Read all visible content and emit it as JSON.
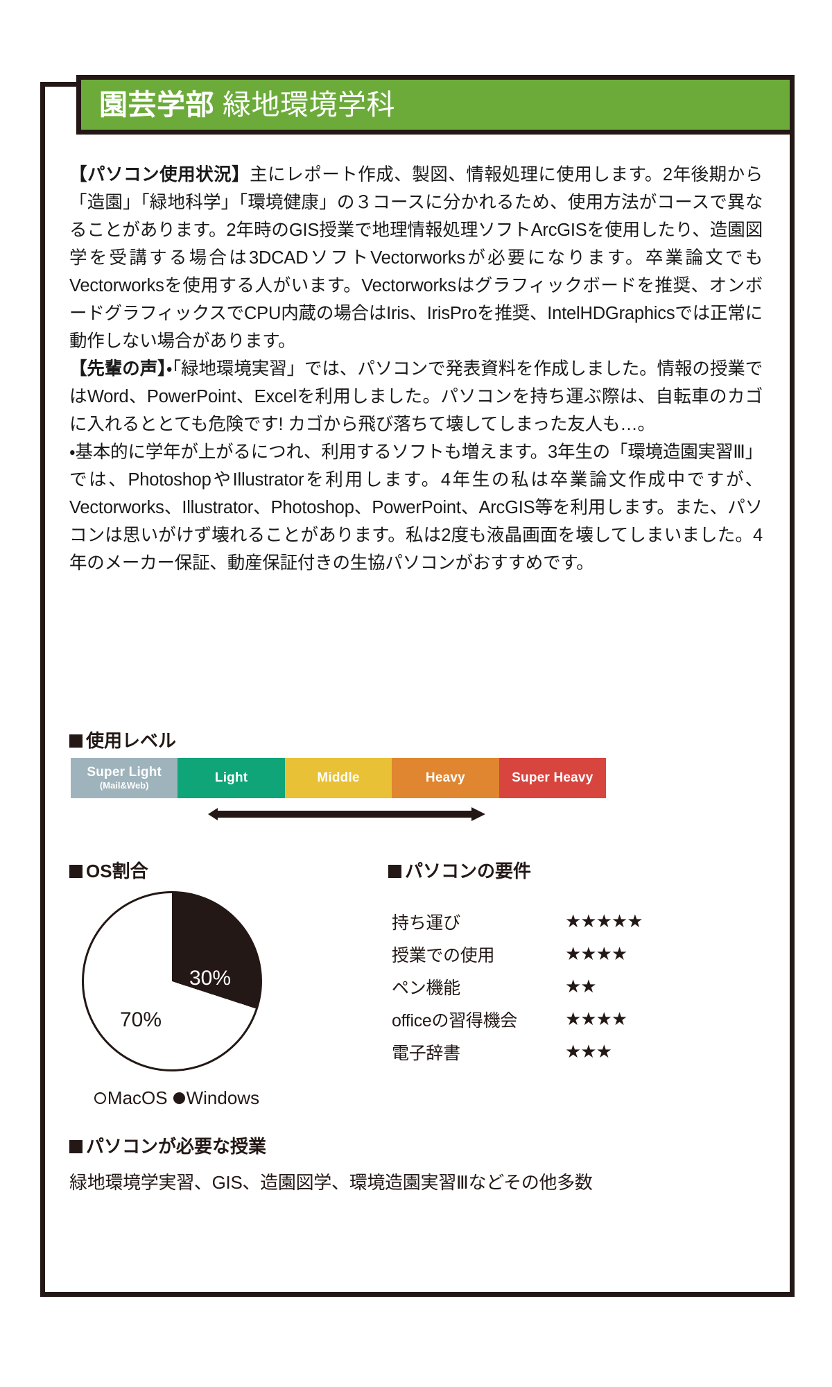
{
  "header": {
    "faculty": "園芸学部",
    "department": "緑地環境学科",
    "band_color": "#6cab3a"
  },
  "body": {
    "paragraph1": "【パソコン使用状況】主にレポート作成、製図、情報処理に使用します。2年後期から「造園」「緑地科学」「環境健康」の３コースに分かれるため、使用方法がコースで異なることがあります。2年時のGIS授業で地理情報処理ソフトArcGISを使用したり、造園図学を受講する場合は3DCADソフトVectorworksが必要になります。卒業論文でもVectorworksを使用する人がいます。Vectorworksはグラフィックボードを推奨、オンボードグラフィックスでCPU内蔵の場合はIris、IrisProを推奨、IntelHDGraphicsでは正常に動作しない場合があります。",
    "paragraph1_bold": "【パソコン使用状況】",
    "paragraph2": "【先輩の声】・「緑地環境実習」では、パソコンで発表資料を作成しました。情報の授業ではWord、PowerPoint、Excelを利用しました。パソコンを持ち運ぶ際は、自転車のカゴに入れるととても危険です! カゴから飛び落ちて壊してしまった友人も…。",
    "paragraph2_bold": "【先輩の声】",
    "paragraph3": "・基本的に学年が上がるにつれ、利用するソフトも増えます。3年生の「環境造園実習Ⅲ」では、PhotoshopやIllustratorを利用します。4年生の私は卒業論文作成中ですが、Vectorworks、Illustrator、Photoshop、PowerPoint、ArcGIS等を利用します。また、パソコンは思いがけず壊れることがあります。私は2度も液晶画面を壊してしまいました。4年のメーカー保証、動産保証付きの生協パソコンがおすすめです。"
  },
  "usage_level": {
    "heading": "使用レベル",
    "segments": [
      {
        "label": "Super Light",
        "sublabel": "(Mail&Web)",
        "color": "#9fb3bc"
      },
      {
        "label": "Light",
        "sublabel": "",
        "color": "#0fa578"
      },
      {
        "label": "Middle",
        "sublabel": "",
        "color": "#e9c136"
      },
      {
        "label": "Heavy",
        "sublabel": "",
        "color": "#e08631"
      },
      {
        "label": "Super Heavy",
        "sublabel": "",
        "color": "#d8453f"
      }
    ],
    "arrow_color": "#231815"
  },
  "os_chart": {
    "heading": "OS割合",
    "legend_mac": "MacOS",
    "legend_win": "Windows"
  },
  "chart_data": {
    "type": "pie",
    "title": "OS割合",
    "categories": [
      "Windows",
      "MacOS"
    ],
    "values": [
      30,
      70
    ],
    "labels": [
      "30%",
      "70%"
    ],
    "colors": [
      "#231815",
      "#ffffff"
    ],
    "legend": [
      "MacOS",
      "Windows"
    ],
    "legend_position": "bottom"
  },
  "requirements": {
    "heading": "パソコンの要件",
    "rows": [
      {
        "name": "持ち運び",
        "stars": "★★★★★",
        "count": 5
      },
      {
        "name": "授業での使用",
        "stars": "★★★★",
        "count": 4
      },
      {
        "name": "ペン機能",
        "stars": "★★",
        "count": 2
      },
      {
        "name": "officeの習得機会",
        "stars": "★★★★",
        "count": 4
      },
      {
        "name": "電子辞書",
        "stars": "★★★",
        "count": 3
      }
    ]
  },
  "classes": {
    "heading": "パソコンが必要な授業",
    "text": "緑地環境学実習、GIS、造園図学、環境造園実習Ⅲなどその他多数"
  }
}
